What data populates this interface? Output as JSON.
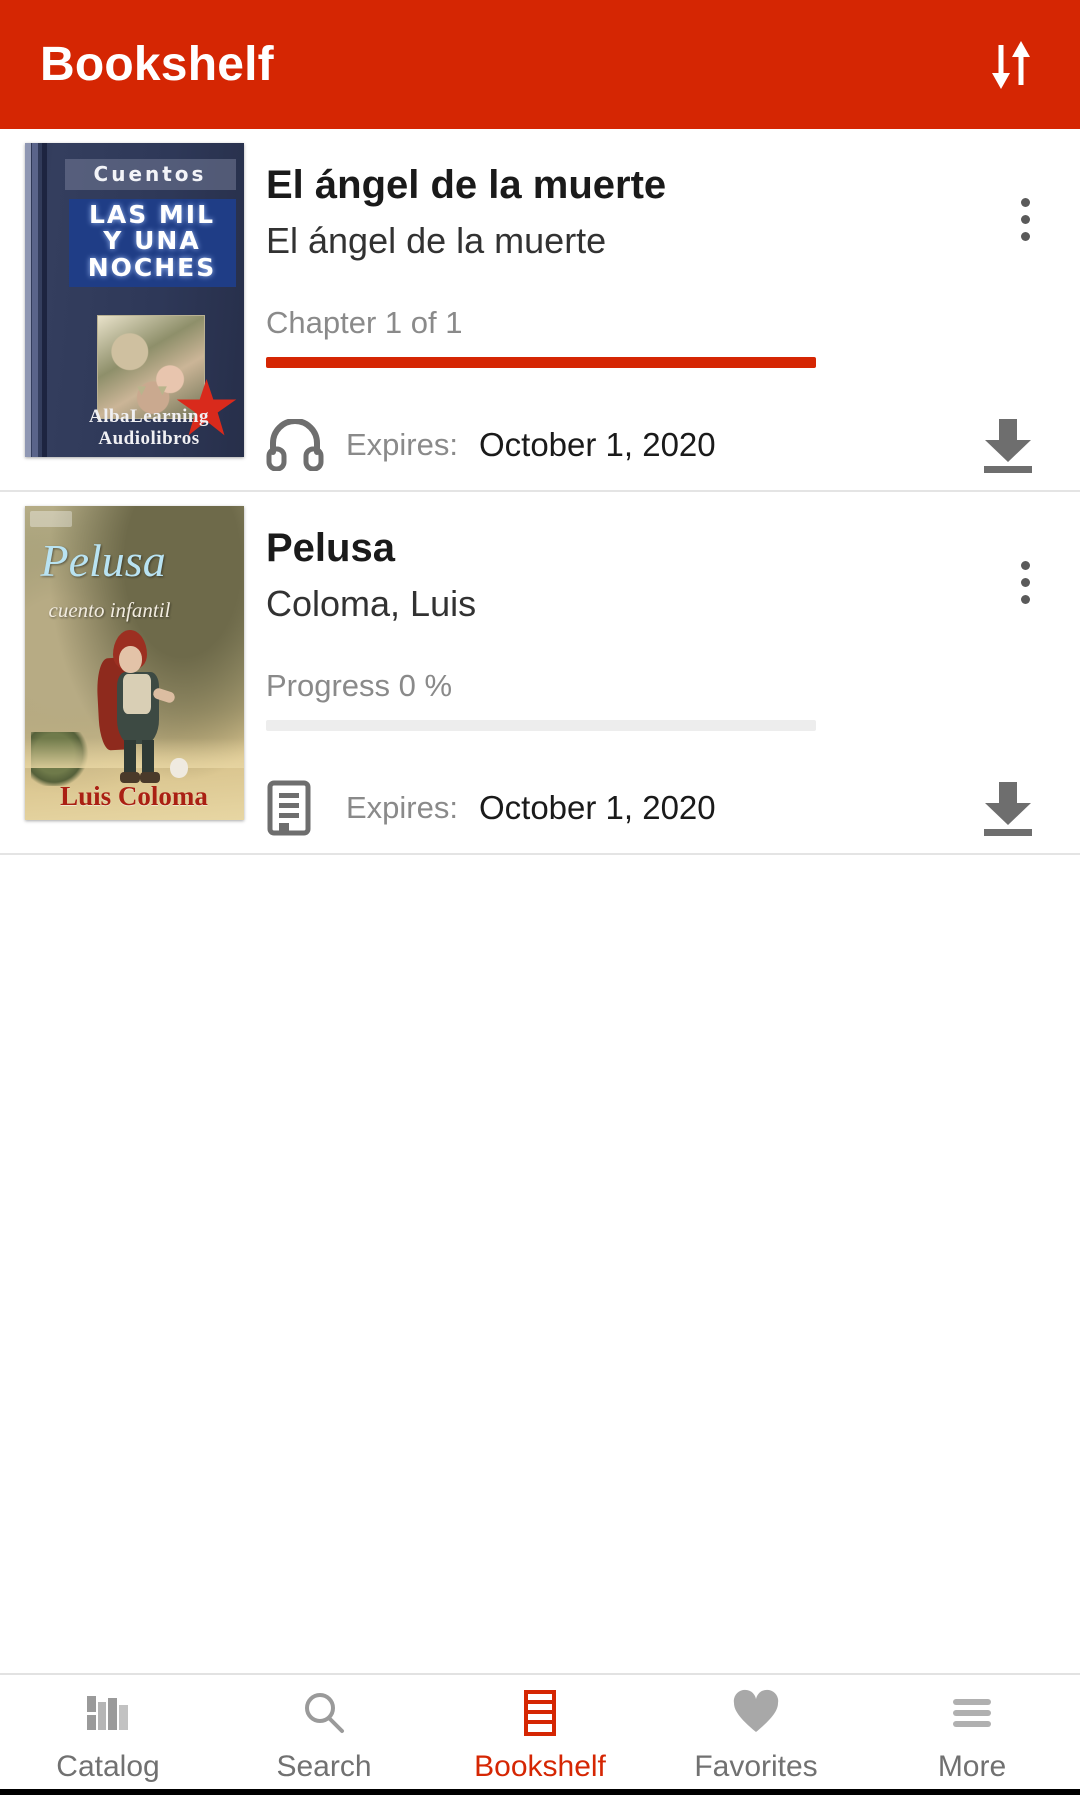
{
  "appbar": {
    "title": "Bookshelf",
    "sort_icon": "sort-arrows-icon"
  },
  "colors": {
    "accent": "#d52603",
    "appbar_bg": "#d52603",
    "muted_text": "#8a8a8a",
    "primary_text": "#1a1a1a",
    "track": "#ededed",
    "icon_gray": "#6e6e6e"
  },
  "books": [
    {
      "title": "El ángel de la muerte",
      "author": "El ángel de la muerte",
      "progress_label": "Chapter 1 of 1",
      "progress_percent": 100,
      "format": "audiobook",
      "format_icon": "headphones-icon",
      "expires_label": "Expires:",
      "expires_date": "October 1, 2020",
      "overflow_icon": "more-vertical-icon",
      "download_icon": "download-icon",
      "cover": {
        "series": "Cuentos",
        "title_lines": [
          "LAS MIL",
          "Y UNA",
          "NOCHES"
        ],
        "publisher_lines": [
          "AlbaLearning",
          "Audiolibros"
        ]
      }
    },
    {
      "title": "Pelusa",
      "author": "Coloma, Luis",
      "progress_label": "Progress 0 %",
      "progress_percent": 0,
      "format": "ebook",
      "format_icon": "ebook-icon",
      "expires_label": "Expires:",
      "expires_date": "October 1, 2020",
      "overflow_icon": "more-vertical-icon",
      "download_icon": "download-icon",
      "cover": {
        "title": "Pelusa",
        "subtitle": "cuento infantil",
        "author": "Luis Coloma"
      }
    }
  ],
  "bottom_nav": {
    "items": [
      {
        "label": "Catalog",
        "icon": "books-icon",
        "active": false
      },
      {
        "label": "Search",
        "icon": "search-icon",
        "active": false
      },
      {
        "label": "Bookshelf",
        "icon": "bookshelf-icon",
        "active": true
      },
      {
        "label": "Favorites",
        "icon": "heart-icon",
        "active": false
      },
      {
        "label": "More",
        "icon": "menu-icon",
        "active": false
      }
    ]
  }
}
